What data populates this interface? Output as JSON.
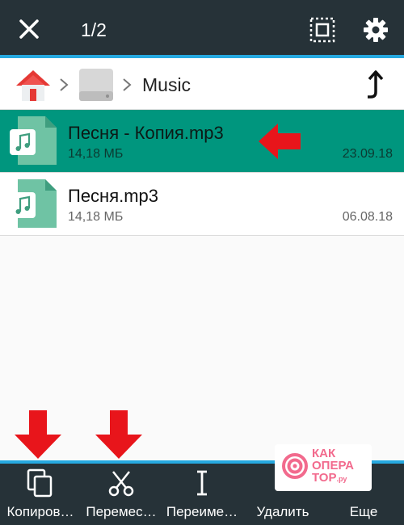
{
  "topbar": {
    "selection_count": "1/2"
  },
  "breadcrumb": {
    "folder": "Music"
  },
  "files": [
    {
      "name": "Песня - Копия.mp3",
      "size": "14,18 МБ",
      "date": "23.09.18",
      "selected": true
    },
    {
      "name": "Песня.mp3",
      "size": "14,18 МБ",
      "date": "06.08.18",
      "selected": false
    }
  ],
  "bottombar": {
    "copy": "Копиров…",
    "move": "Перемес…",
    "rename": "Переиме…",
    "delete": "Удалить",
    "more": "Еще"
  },
  "watermark": {
    "line1": "КАК",
    "line2": "ОПЕРА",
    "line3": "ТОР",
    "suffix": ".ру"
  },
  "colors": {
    "bar_bg": "#263238",
    "accent_line": "#26a9e0",
    "selected_row": "#00967e",
    "annotation_arrow": "#e8151b"
  },
  "icons": {
    "close": "close-icon",
    "select_all": "select-all-icon",
    "settings": "gear-icon",
    "home": "home-icon",
    "storage": "storage-drive-icon",
    "up": "up-level-icon",
    "file": "music-file-icon",
    "copy": "copy-icon",
    "move": "scissors-icon",
    "rename": "text-cursor-icon"
  }
}
